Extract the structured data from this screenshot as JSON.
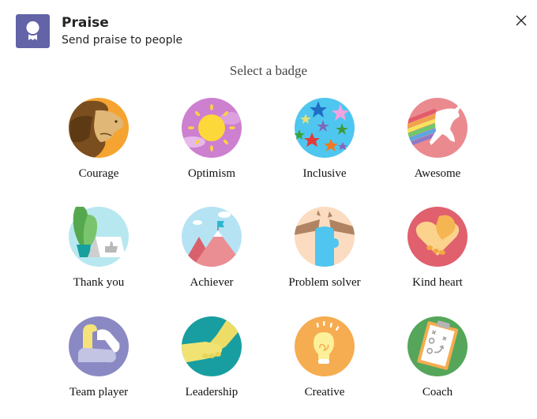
{
  "header": {
    "app_icon": "praise-ribbon-icon",
    "title": "Praise",
    "subtitle": "Send praise to people",
    "close_icon": "close-icon",
    "accent_color": "#6264a7"
  },
  "main": {
    "heading": "Select a badge",
    "badges": [
      {
        "label": "Courage",
        "icon": "lion-icon",
        "color": "#f5a431"
      },
      {
        "label": "Optimism",
        "icon": "sun-icon",
        "color": "#cd7fd0"
      },
      {
        "label": "Inclusive",
        "icon": "stars-icon",
        "color": "#4fc6ef"
      },
      {
        "label": "Awesome",
        "icon": "unicorn-icon",
        "color": "#ea8a8f"
      },
      {
        "label": "Thank you",
        "icon": "plant-thumbs-up-icon",
        "color": "#b8e8ef"
      },
      {
        "label": "Achiever",
        "icon": "mountain-flag-icon",
        "color": "#b5e3f4"
      },
      {
        "label": "Problem solver",
        "icon": "fist-breaking-icon",
        "color": "#fbdcc0"
      },
      {
        "label": "Kind heart",
        "icon": "heart-handshake-icon",
        "color": "#e0606e"
      },
      {
        "label": "Team player",
        "icon": "linked-arms-icon",
        "color": "#8b89c3"
      },
      {
        "label": "Leadership",
        "icon": "handshake-icon",
        "color": "#189ea0"
      },
      {
        "label": "Creative",
        "icon": "light-bulb-icon",
        "color": "#f6ac50"
      },
      {
        "label": "Coach",
        "icon": "clipboard-plays-icon",
        "color": "#55a65a"
      }
    ]
  }
}
